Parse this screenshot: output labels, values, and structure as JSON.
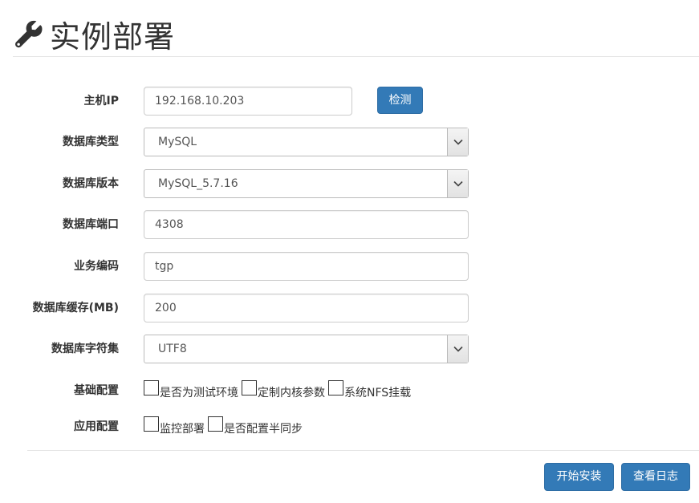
{
  "page": {
    "title": "实例部署",
    "title_icon": "wrench-icon"
  },
  "form": {
    "host_ip": {
      "label": "主机IP",
      "value": "192.168.10.203",
      "detect_button": "检测"
    },
    "db_type": {
      "label": "数据库类型",
      "selected": "MySQL"
    },
    "db_version": {
      "label": "数据库版本",
      "selected": "MySQL_5.7.16"
    },
    "db_port": {
      "label": "数据库端口",
      "value": "4308"
    },
    "business_code": {
      "label": "业务编码",
      "value": "tgp"
    },
    "db_cache": {
      "label": "数据库缓存(MB)",
      "value": "200"
    },
    "db_charset": {
      "label": "数据库字符集",
      "selected": "UTF8"
    },
    "basic_config": {
      "label": "基础配置",
      "options": [
        {
          "label": "是否为测试环境",
          "checked": false
        },
        {
          "label": "定制内核参数",
          "checked": false
        },
        {
          "label": "系统NFS挂载",
          "checked": false
        }
      ]
    },
    "app_config": {
      "label": "应用配置",
      "options": [
        {
          "label": "监控部署",
          "checked": false
        },
        {
          "label": "是否配置半同步",
          "checked": false
        }
      ]
    }
  },
  "actions": {
    "install": "开始安装",
    "view_log": "查看日志"
  },
  "colors": {
    "primary": "#337ab7",
    "primary_border": "#2e6da4"
  }
}
